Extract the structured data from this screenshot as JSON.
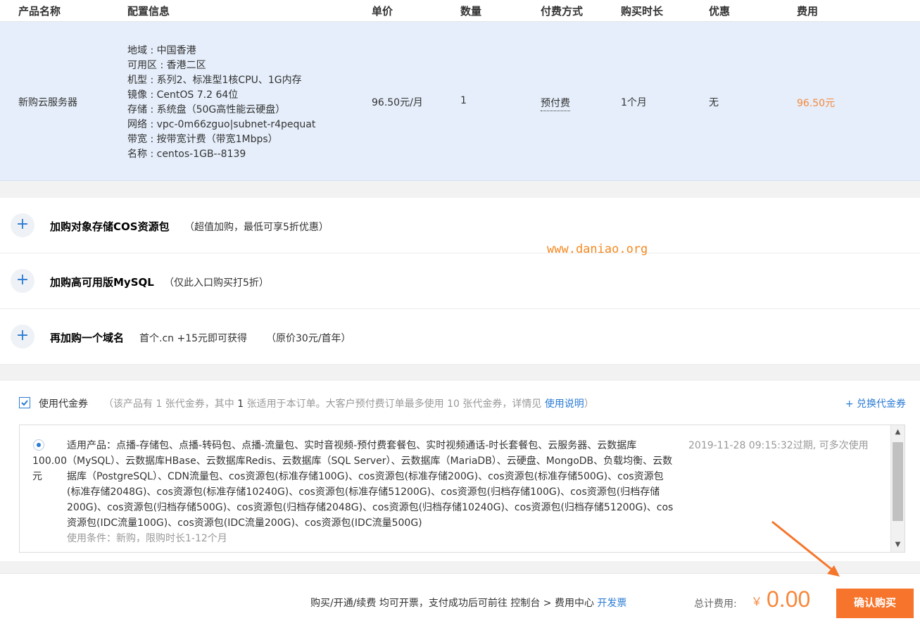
{
  "table": {
    "headers": [
      "产品名称",
      "配置信息",
      "单价",
      "数量",
      "付费方式",
      "购买时长",
      "优惠",
      "费用"
    ]
  },
  "order": {
    "product": "新购云服务器",
    "config": [
      "地域 : 中国香港",
      "可用区 : 香港二区",
      "机型 : 系列2、标准型1核CPU、1G内存",
      "镜像 : CentOS 7.2 64位",
      "存储 : 系统盘（50G高性能云硬盘）",
      "网络 : vpc-0m66zguo|subnet-r4pequat",
      "带宽 : 按带宽计费（带宽1Mbps）",
      "名称 : centos-1GB--8139"
    ],
    "unit_price": "96.50元/月",
    "quantity": "1",
    "billing": "预付费",
    "duration": "1个月",
    "discount": "无",
    "cost": "96.50元"
  },
  "addons": [
    {
      "title": "加购对象存储COS资源包",
      "note": "（超值加购，最低可享5折优惠）"
    },
    {
      "title": "加购高可用版MySQL",
      "note": "（仅此入口购买打5折）"
    },
    {
      "title": "再加购一个域名",
      "extra": "首个.cn +15元即可获得",
      "note": "（原价30元/首年）"
    }
  ],
  "watermark": "www.daniao.org",
  "voucher": {
    "use_label": "使用代金券",
    "desc_prefix": "（该产品有 1 张代金券，其中 ",
    "desc_count": "1",
    "desc_suffix": " 张适用于本订单。大客户预付费订单最多使用 10 张代金券，详情见 ",
    "desc_link": "使用说明",
    "desc_end": "）",
    "exchange": "+ 兑换代金券",
    "amount": "100.00元",
    "products": "适用产品：点播-存储包、点播-转码包、点播-流量包、实时音视频-预付费套餐包、实时视频通话-时长套餐包、云服务器、云数据库（MySQL）、云数据库HBase、云数据库Redis、云数据库（SQL Server）、云数据库（MariaDB）、云硬盘、MongoDB、负载均衡、云数据库（PostgreSQL）、CDN流量包、cos资源包(标准存储100G)、cos资源包(标准存储200G)、cos资源包(标准存储500G)、cos资源包(标准存储2048G)、cos资源包(标准存储10240G)、cos资源包(标准存储51200G)、cos资源包(归档存储100G)、cos资源包(归档存储200G)、cos资源包(归档存储500G)、cos资源包(归档存储2048G)、cos资源包(归档存储10240G)、cos资源包(归档存储51200G)、cos资源包(IDC流量100G)、cos资源包(IDC流量200G)、cos资源包(IDC流量500G)",
    "condition": "使用条件：新购，限购时长1-12个月",
    "expiry": "2019-11-28 09:15:32过期, 可多次使用"
  },
  "footer": {
    "invoice_text": "购买/开通/续费 均可开票，支付成功后可前往 控制台 > 费用中心 ",
    "invoice_link": "开发票",
    "total_label": "总计费用:",
    "currency": "￥",
    "total": "0.00",
    "confirm": "确认购买"
  },
  "colors": {
    "accent": "#2a7bd5",
    "price": "#f6883b",
    "confirm_button": "#f6742b",
    "row_highlight": "#e5eefa"
  },
  "icons": [
    "plus-icon",
    "checkbox-checked-icon",
    "radio-selected-icon",
    "scroll-up-icon",
    "scroll-down-icon",
    "arrow-annotation-icon"
  ]
}
